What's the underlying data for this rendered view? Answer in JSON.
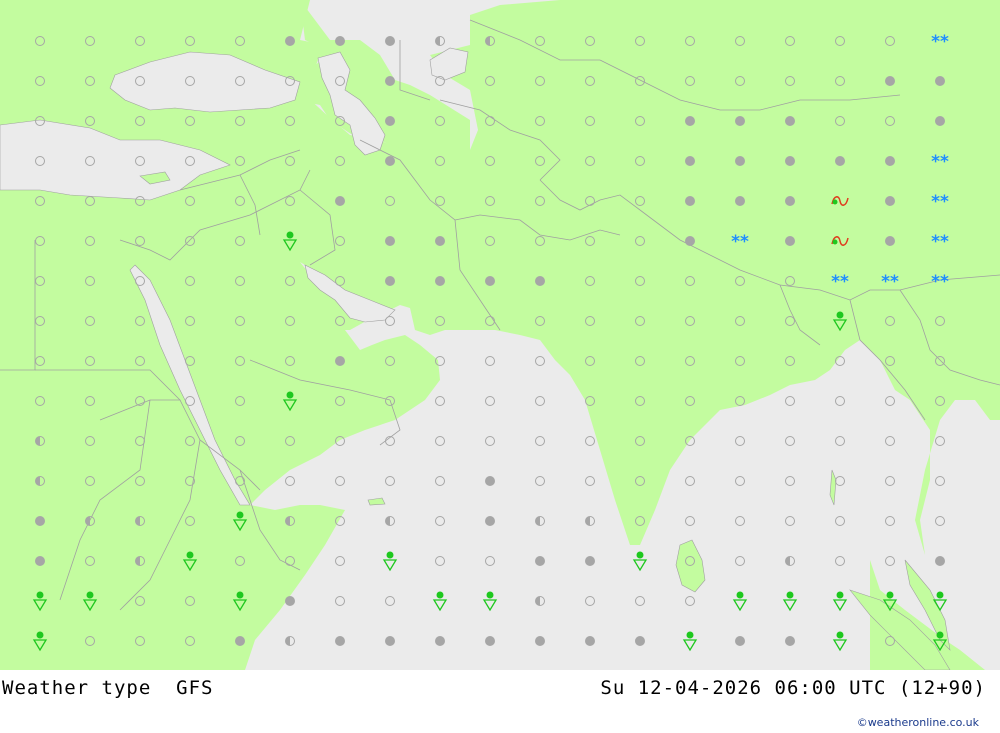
{
  "footer": {
    "left_label": "Weather type  GFS",
    "right_label": "Su 12-04-2026 06:00 UTC (12+90)",
    "credit": "©weatheronline.co.uk"
  },
  "colors": {
    "land": "#c3fc9f",
    "sea": "#ebebeb",
    "border": "#a0a0a0",
    "marker_gray": "#a6a6a6",
    "rain_green": "#1ec81e",
    "snow_blue": "#1e8cff",
    "mix_red": "#e03c1e"
  },
  "grid": {
    "rows": [
      ".O.O.O.O.O.G.G.G.H.H.O.O.O.O.O.O.O.O.S",
      ".O.O.O.O.O.O.O.G.O.O.O.O.O.O.O.O.O.G.G",
      ".O.O.O.O.O.O.O.G.O.O.O.O.O.G.G.G.O.O.G",
      ".O.O.O.O.O.O.O.G.O.O.O.O.O.G.G.G.G.G.S",
      ".O.O.O.O.O.O.G.O.O.O.O.O.O.G.G.G.M.G.S",
      ".O.O.O.O.O.R.O.G.G.O.O.O.O.G.S.G.M.G.S",
      ".O.O.O.O.O.O.O.G.G.G.G.O.O.O.O.O.S.S.S",
      ".O.O.O.O.O.O.O.O.O.O.O.O.O.O.O.O.R.O.O",
      ".O.O.O.O.O.O.G.O.O.O.O.O.O.O.O.O.O.O.O",
      ".O.O.O.O.O.R.O.O.O.O.O.O.O.O.O.O.O.O.O",
      ".H.O.O.O.O.O.O.O.O.O.O.O.O.O.O.O.O.O.O",
      ".H.O.O.O.O.O.O.O.O.G.O.O.O.O.O.O.O.O.O",
      ".G.H.H.O.R.H.O.H.O.G.H.H.O.O.O.O.O.O.O",
      ".G.O.H.R.O.O.O.R.O.O.G.G.R.O.O.H.O.O.G",
      ".R.R.O.O.R.G.O.O.R.R.H.O.O.O.R.R.R.R.R",
      ".R.O.O.O.G.H.G.G.G.G.G.G.G.R.G.G.R.O.R"
    ]
  }
}
